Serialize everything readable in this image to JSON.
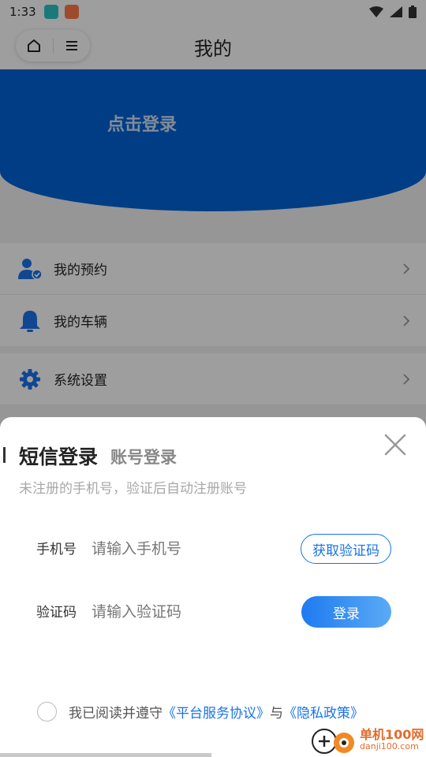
{
  "status_bar": {
    "time": "1:33"
  },
  "nav": {
    "title": "我的"
  },
  "header": {
    "login_prompt": "点击登录"
  },
  "menu": [
    {
      "label": "我的预约",
      "icon": "user-check-icon"
    },
    {
      "label": "我的车辆",
      "icon": "bell-icon"
    },
    {
      "label": "系统设置",
      "icon": "gear-icon"
    }
  ],
  "login_sheet": {
    "tab_active": "短信登录",
    "tab_inactive": "账号登录",
    "hint": "未注册的手机号，验证后自动注册账号",
    "phone": {
      "label": "手机号",
      "placeholder": "请输入手机号"
    },
    "code": {
      "label": "验证码",
      "placeholder": "请输入验证码"
    },
    "get_code_label": "获取验证码",
    "login_label": "登录",
    "agreement": {
      "prefix": "我已阅读并遵守",
      "service_link": "《平台服务协议》",
      "conjunction": "与",
      "privacy_link": "《隐私政策》"
    }
  },
  "watermark": {
    "main": "单机100网",
    "sub": "danji100.com"
  },
  "colors": {
    "brand_blue": "#0063d6",
    "link_blue": "#1a73e8"
  }
}
